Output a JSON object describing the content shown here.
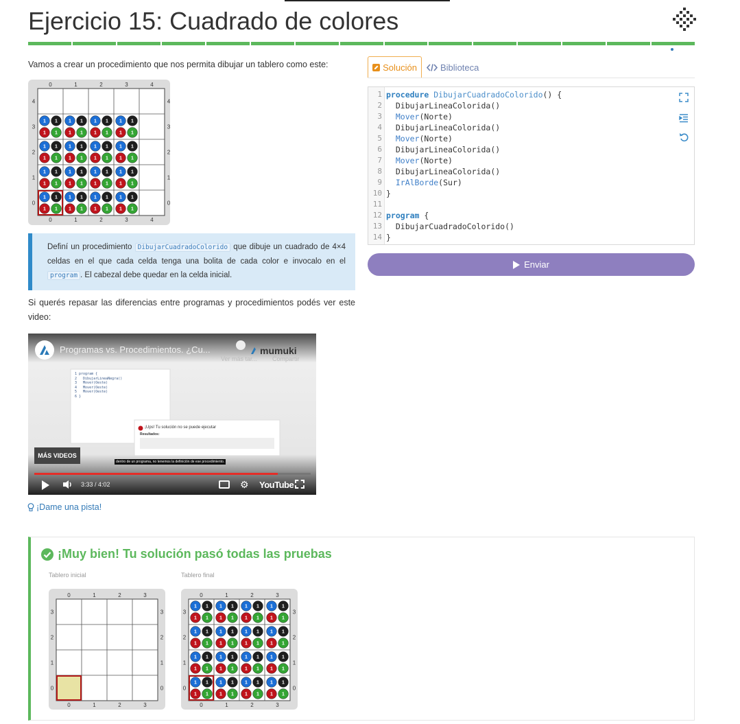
{
  "page": {
    "title": "Ejercicio 15: Cuadrado de colores",
    "progress_segments": 15
  },
  "intro": "Vamos a crear un procedimiento que nos permita dibujar un tablero como este:",
  "example_board": {
    "cols": 5,
    "rows": 5,
    "col_labels": [
      "0",
      "1",
      "2",
      "3",
      "4"
    ],
    "row_labels": [
      "4",
      "3",
      "2",
      "1",
      "0"
    ],
    "ball_label": "1"
  },
  "callout": {
    "part1": "Definí un procedimiento",
    "code1": "DibujarCuadradoColorido",
    "part2": "que dibuje un cuadrado de 4×4 celdas en el que cada celda tenga una bolita de cada color e invocalo en el",
    "code2": "program",
    "part3": ". El cabezal debe quedar en la celda inicial."
  },
  "video_intro": "Si querés repasar las diferencias entre programas y procedimientos podés ver este video:",
  "video": {
    "title": "Programas vs. Procedimientos. ¿Cu...",
    "brand": "mumuki",
    "watch_later": "Ver más tar...",
    "share": "Compartir",
    "more_videos": "MÁS VIDEOS",
    "caption": "dentro de un programa, no tenemos la definición de ese procedimiento.",
    "error_title": "¡Ups! Tu solución no se puede ejecutar",
    "error_label": "Resultados:",
    "time": "3:33 / 4:02",
    "progress": 0.88,
    "youtube": "YouTube",
    "code_lines": [
      "program {",
      "  DibujarLineaNegra()",
      "  Mover(Oeste)",
      "  Mover(Oeste)",
      "  Mover(Oeste)",
      "}"
    ]
  },
  "hint": "¡Dame una pista!",
  "tabs": {
    "solution": "Solución",
    "library": "Biblioteca"
  },
  "editor": {
    "lines": [
      {
        "n": "1",
        "html": "<span class='kw'>procedure</span> <span class='fn'>DibujarCuadradoColorido</span>() {"
      },
      {
        "n": "2",
        "html": "  DibujarLineaColorida()"
      },
      {
        "n": "3",
        "html": "  <span class='prim'>Mover</span>(Norte)"
      },
      {
        "n": "4",
        "html": "  DibujarLineaColorida()"
      },
      {
        "n": "5",
        "html": "  <span class='prim'>Mover</span>(Norte)"
      },
      {
        "n": "6",
        "html": "  DibujarLineaColorida()"
      },
      {
        "n": "7",
        "html": "  <span class='prim'>Mover</span>(Norte)"
      },
      {
        "n": "8",
        "html": "  DibujarLineaColorida()"
      },
      {
        "n": "9",
        "html": "  <span class='prim'>IrAlBorde</span>(Sur)"
      },
      {
        "n": "10",
        "html": "}"
      },
      {
        "n": "11",
        "html": ""
      },
      {
        "n": "12",
        "html": "<span class='kw'>program</span> {"
      },
      {
        "n": "13",
        "html": "  DibujarCuadradoColorido()"
      },
      {
        "n": "14",
        "html": "}"
      }
    ]
  },
  "send_label": "Enviar",
  "result": {
    "title": "¡Muy bien! Tu solución pasó todas las pruebas",
    "initial_label": "Tablero inicial",
    "final_label": "Tablero final",
    "col_labels": [
      "0",
      "1",
      "2",
      "3"
    ],
    "row_labels": [
      "3",
      "2",
      "1",
      "0"
    ]
  },
  "colors": {
    "green": "#5cb85c",
    "blue_ball": "#1c6fd6",
    "black_ball": "#1e1e1e",
    "red_ball": "#c0141c",
    "green_ball": "#34a534",
    "head": "#b01818",
    "purple": "#8e7fbf"
  }
}
